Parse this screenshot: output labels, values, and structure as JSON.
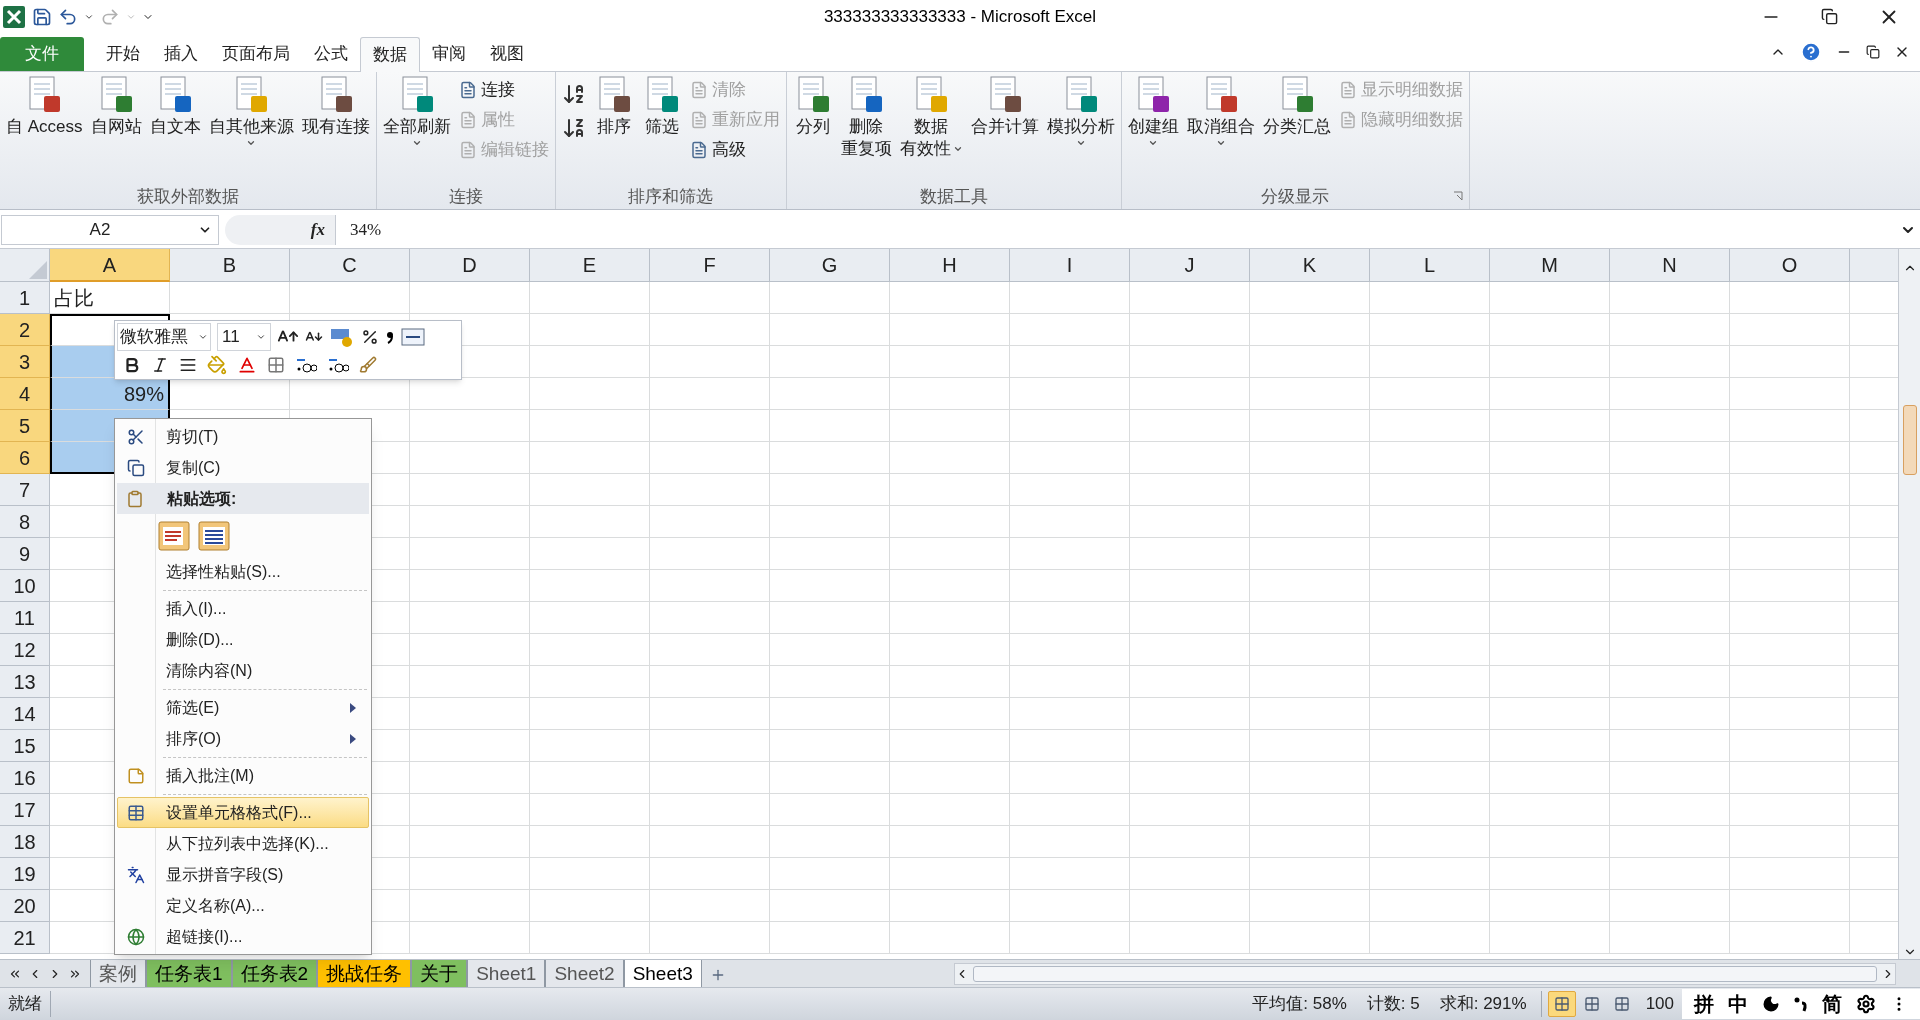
{
  "title_bar": {
    "title": "333333333333333 - Microsoft Excel"
  },
  "ribbon_tabs": [
    {
      "label": "文件",
      "kind": "file",
      "selected": false
    },
    {
      "label": "开始",
      "kind": "tab",
      "selected": false
    },
    {
      "label": "插入",
      "kind": "tab",
      "selected": false
    },
    {
      "label": "页面布局",
      "kind": "tab",
      "selected": false
    },
    {
      "label": "公式",
      "kind": "tab",
      "selected": false
    },
    {
      "label": "数据",
      "kind": "tab",
      "selected": true
    },
    {
      "label": "审阅",
      "kind": "tab",
      "selected": false
    },
    {
      "label": "视图",
      "kind": "tab",
      "selected": false
    }
  ],
  "ribbon_groups": [
    {
      "label": "获取外部数据",
      "items": [
        {
          "kind": "large",
          "lines": [
            "自 Access"
          ],
          "dropdown": false
        },
        {
          "kind": "large",
          "lines": [
            "自网站"
          ],
          "dropdown": false
        },
        {
          "kind": "large",
          "lines": [
            "自文本"
          ],
          "dropdown": false
        },
        {
          "kind": "large",
          "lines": [
            "自其他来源"
          ],
          "dropdown": true
        },
        {
          "kind": "large",
          "lines": [
            "现有连接"
          ],
          "dropdown": false
        }
      ]
    },
    {
      "label": "连接",
      "items": [
        {
          "kind": "large",
          "lines": [
            "全部刷新"
          ],
          "dropdown": true
        },
        {
          "kind": "stack",
          "entries": [
            {
              "label": "连接",
              "disabled": false
            },
            {
              "label": "属性",
              "disabled": true
            },
            {
              "label": "编辑链接",
              "disabled": true
            }
          ]
        }
      ]
    },
    {
      "label": "排序和筛选",
      "items": [
        {
          "kind": "sort"
        },
        {
          "kind": "large",
          "lines": [
            "排序"
          ],
          "dropdown": false
        },
        {
          "kind": "large",
          "lines": [
            "筛选"
          ],
          "dropdown": false
        },
        {
          "kind": "stack",
          "entries": [
            {
              "label": "清除",
              "disabled": true
            },
            {
              "label": "重新应用",
              "disabled": true
            },
            {
              "label": "高级",
              "disabled": false
            }
          ]
        }
      ]
    },
    {
      "label": "数据工具",
      "items": [
        {
          "kind": "large",
          "lines": [
            "分列"
          ],
          "dropdown": false
        },
        {
          "kind": "large",
          "lines": [
            "删除",
            "重复项"
          ],
          "dropdown": false
        },
        {
          "kind": "large",
          "lines": [
            "数据",
            "有效性"
          ],
          "dropdown": true
        },
        {
          "kind": "large",
          "lines": [
            "合并计算"
          ],
          "dropdown": false
        },
        {
          "kind": "large",
          "lines": [
            "模拟分析"
          ],
          "dropdown": true
        }
      ]
    },
    {
      "label": "分级显示",
      "launcher": true,
      "items": [
        {
          "kind": "large",
          "lines": [
            "创建组"
          ],
          "dropdown": true
        },
        {
          "kind": "large",
          "lines": [
            "取消组合"
          ],
          "dropdown": true
        },
        {
          "kind": "large",
          "lines": [
            "分类汇总"
          ],
          "dropdown": false
        },
        {
          "kind": "stack",
          "entries": [
            {
              "label": "显示明细数据",
              "disabled": true
            },
            {
              "label": "隐藏明细数据",
              "disabled": true
            }
          ]
        }
      ]
    }
  ],
  "formula_bar": {
    "name_box": "A2",
    "fx": "fx",
    "value": "34%"
  },
  "columns": [
    {
      "label": "A",
      "selected": true
    },
    {
      "label": "B",
      "selected": false
    },
    {
      "label": "C",
      "selected": false
    },
    {
      "label": "D",
      "selected": false
    },
    {
      "label": "E",
      "selected": false
    },
    {
      "label": "F",
      "selected": false
    },
    {
      "label": "G",
      "selected": false
    },
    {
      "label": "H",
      "selected": false
    },
    {
      "label": "I",
      "selected": false
    },
    {
      "label": "J",
      "selected": false
    },
    {
      "label": "K",
      "selected": false
    },
    {
      "label": "L",
      "selected": false
    },
    {
      "label": "M",
      "selected": false
    },
    {
      "label": "N",
      "selected": false
    },
    {
      "label": "O",
      "selected": false
    }
  ],
  "rows": [
    {
      "header": "1",
      "in_selection": false,
      "active": false,
      "a": "占比"
    },
    {
      "header": "2",
      "in_selection": true,
      "active": true
    },
    {
      "header": "3",
      "in_selection": true,
      "active": false
    },
    {
      "header": "4",
      "in_selection": true,
      "active": false,
      "a": "89%"
    },
    {
      "header": "5",
      "in_selection": true,
      "active": false
    },
    {
      "header": "6",
      "in_selection": true,
      "active": false
    },
    {
      "header": "7",
      "in_selection": false,
      "active": false
    },
    {
      "header": "8",
      "in_selection": false,
      "active": false
    },
    {
      "header": "9",
      "in_selection": false,
      "active": false
    },
    {
      "header": "10",
      "in_selection": false,
      "active": false
    },
    {
      "header": "11",
      "in_selection": false,
      "active": false
    },
    {
      "header": "12",
      "in_selection": false,
      "active": false
    },
    {
      "header": "13",
      "in_selection": false,
      "active": false
    },
    {
      "header": "14",
      "in_selection": false,
      "active": false
    },
    {
      "header": "15",
      "in_selection": false,
      "active": false
    },
    {
      "header": "16",
      "in_selection": false,
      "active": false
    },
    {
      "header": "17",
      "in_selection": false,
      "active": false
    },
    {
      "header": "18",
      "in_selection": false,
      "active": false
    },
    {
      "header": "19",
      "in_selection": false,
      "active": false
    },
    {
      "header": "20",
      "in_selection": false,
      "active": false
    },
    {
      "header": "21",
      "in_selection": false,
      "active": false
    }
  ],
  "mini_toolbar": {
    "font": "微软雅黑",
    "size": "11"
  },
  "context_menu": [
    {
      "kind": "item",
      "label": "剪切(T)",
      "submenu": false,
      "highlighted": false
    },
    {
      "kind": "item",
      "label": "复制(C)",
      "submenu": false,
      "highlighted": false
    },
    {
      "kind": "heading",
      "label": "粘贴选项:"
    },
    {
      "kind": "paste_icons"
    },
    {
      "kind": "item",
      "label": "选择性粘贴(S)...",
      "submenu": false,
      "highlighted": false
    },
    {
      "kind": "separator"
    },
    {
      "kind": "item",
      "label": "插入(I)...",
      "submenu": false,
      "highlighted": false
    },
    {
      "kind": "item",
      "label": "删除(D)...",
      "submenu": false,
      "highlighted": false
    },
    {
      "kind": "item",
      "label": "清除内容(N)",
      "submenu": false,
      "highlighted": false
    },
    {
      "kind": "separator"
    },
    {
      "kind": "item",
      "label": "筛选(E)",
      "submenu": true,
      "highlighted": false
    },
    {
      "kind": "item",
      "label": "排序(O)",
      "submenu": true,
      "highlighted": false
    },
    {
      "kind": "separator"
    },
    {
      "kind": "item",
      "label": "插入批注(M)",
      "submenu": false,
      "highlighted": false
    },
    {
      "kind": "separator"
    },
    {
      "kind": "item",
      "label": "设置单元格格式(F)...",
      "submenu": false,
      "highlighted": true
    },
    {
      "kind": "item",
      "label": "从下拉列表中选择(K)...",
      "submenu": false,
      "highlighted": false
    },
    {
      "kind": "item",
      "label": "显示拼音字段(S)",
      "submenu": false,
      "highlighted": false
    },
    {
      "kind": "item",
      "label": "定义名称(A)...",
      "submenu": false,
      "highlighted": false
    },
    {
      "kind": "item",
      "label": "超链接(I)...",
      "submenu": false,
      "highlighted": false
    }
  ],
  "sheet_tabs": [
    {
      "label": "案例",
      "selected": false
    },
    {
      "label": "任务表1",
      "selected": false,
      "color": "#7fbf5f"
    },
    {
      "label": "任务表2",
      "selected": false,
      "color": "#7fbf5f"
    },
    {
      "label": "挑战任务",
      "selected": false,
      "color": "#ffc000"
    },
    {
      "label": "关于",
      "selected": false,
      "color": "#7fbf5f"
    },
    {
      "label": "Sheet1",
      "selected": false
    },
    {
      "label": "Sheet2",
      "selected": false
    },
    {
      "label": "Sheet3",
      "selected": true
    }
  ],
  "status_bar": {
    "ready": "就绪",
    "stats": [
      "平均值: 58%",
      "计数: 5",
      "求和: 291%"
    ],
    "views": [
      {
        "selected": true
      },
      {
        "selected": false
      },
      {
        "selected": false
      }
    ],
    "zoom": "100"
  },
  "ime_bar": [
    {
      "kind": "text",
      "label": "拼"
    },
    {
      "kind": "text",
      "label": "中"
    },
    {
      "kind": "moon"
    },
    {
      "kind": "punct"
    },
    {
      "kind": "text",
      "label": "简"
    },
    {
      "kind": "gear"
    },
    {
      "kind": "menu"
    }
  ]
}
